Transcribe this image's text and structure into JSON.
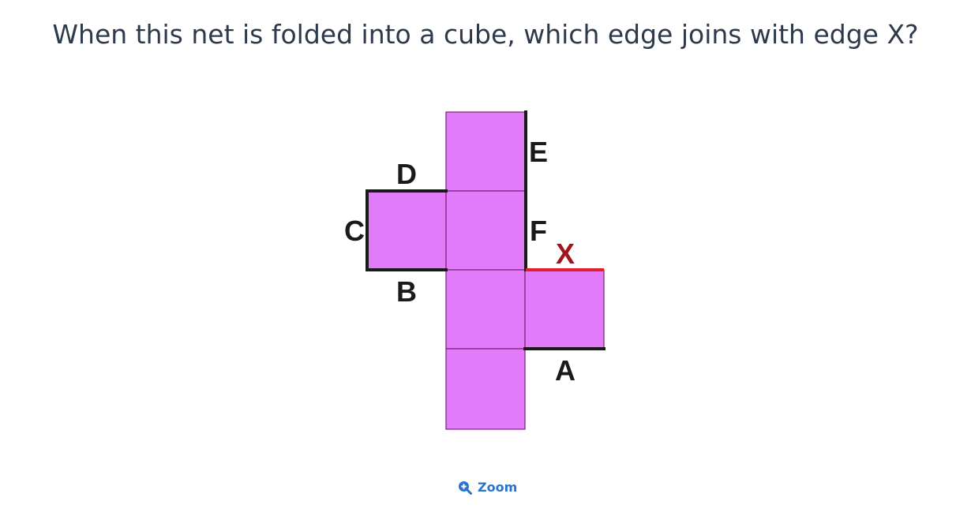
{
  "question": "When this net is folded into a cube, which edge joins with edge X?",
  "edge_labels": {
    "A": "A",
    "B": "B",
    "C": "C",
    "D": "D",
    "E": "E",
    "F": "F",
    "X": "X"
  },
  "colors": {
    "face_fill": "#e27bfa",
    "face_stroke": "#7a1f7a",
    "edge_highlight": "#1a1a1a",
    "target_edge": "#e0202a",
    "target_label": "#a3141a",
    "question_text": "#2c3a4b",
    "zoom_link": "#2a74c9"
  },
  "zoom": {
    "label": "Zoom",
    "icon": "zoom-in-icon"
  }
}
